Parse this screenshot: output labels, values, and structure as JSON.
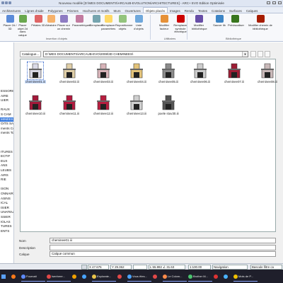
{
  "window": {
    "title": "Nouveau modèle [D:\\MES DOCUMENTS\\ARCAUB-EVOLUTION\\ARCHITECTURES] - ARC+ EVO Edition Optimisée"
  },
  "tabs": [
    "Architectures",
    "Lignes d'aide",
    "Polygones",
    "Prismes",
    "Hachures et motifs",
    "Murs",
    "Ouvertures",
    "Objets placés",
    "Images",
    "Rendu",
    "Textes",
    "Cotations",
    "Surfaces",
    "Calques"
  ],
  "ribbon": {
    "buttons": [
      {
        "label": "Placer 2d / 3D"
      },
      {
        "label": "Placer objet 2d dans calque"
      },
      {
        "label": "Pétales 3D"
      },
      {
        "label": "Aléatoire"
      },
      {
        "label": "Placer sur un chemin"
      },
      {
        "label": "Paramétriques"
      },
      {
        "label": "Remplacer"
      },
      {
        "label": "Remplacer paramètres"
      },
      {
        "label": "Repositionner objets"
      },
      {
        "label": "Liste d'objets"
      },
      {
        "label": "Modifier facteur"
      },
      {
        "label": "Remplacer symbole électrique"
      },
      {
        "label": "Modifier bibliothèque"
      },
      {
        "label": "Sauver lib"
      },
      {
        "label": "Prévisualiser"
      },
      {
        "label": "Modifier chemin de bibliothèque"
      }
    ],
    "groups": [
      "Insertion d'objets",
      "Utilitaires",
      "Bibliothèque"
    ]
  },
  "left_panel": {
    "items": [
      "",
      "",
      "",
      "",
      "",
      "",
      "",
      "",
      "",
      "",
      "ESSORIES",
      "AIRE",
      "UIER",
      "",
      "RAUX",
      "S CAM",
      "MINÉES",
      "OITS SAN",
      "ments Con",
      "ments Tom",
      "",
      "",
      "",
      "ITURES",
      "ECTIF",
      "EUX",
      "ANS",
      "LEUBS",
      "AIRS",
      "RIE",
      "",
      "ISON",
      "ONNAIRES",
      "ASINS",
      "ICAL",
      "ISIER",
      "UNATEUR",
      "SSIER",
      "IOLAS",
      "TURES",
      "ENTS",
      "",
      "",
      "",
      ""
    ],
    "selected_index": 16
  },
  "browser": {
    "catalog_button": "Catalogue...",
    "path": "D:\\MES DOCUMENTS\\ARCAUB-EVO\\2008\\3D CHEMINEES\\",
    "files": [
      {
        "name": "cheminee01.iii",
        "color": "#d9d9e6"
      },
      {
        "name": "cheminee02.iii",
        "color": "#e0cfa8"
      },
      {
        "name": "cheminee03.iii",
        "color": "#d7b3b8"
      },
      {
        "name": "cheminee04.iii",
        "color": "#e3c37a"
      },
      {
        "name": "cheminee05.iii",
        "color": "#8b8b8b"
      },
      {
        "name": "cheminee06.iii",
        "color": "#cccccc"
      },
      {
        "name": "cheminee07.iii",
        "color": "#9d1d35"
      },
      {
        "name": "cheminee08.iii",
        "color": "#c9b9b9"
      },
      {
        "name": "cheminee10.iii",
        "color": "#a3193a"
      },
      {
        "name": "cheminee11.iii",
        "color": "#b21b3f"
      },
      {
        "name": "cheminee12.iii",
        "color": "#b61e3f"
      },
      {
        "name": "cheminee13.iii",
        "color": "#cfcfcf"
      },
      {
        "name": "poele stuv30.iii",
        "color": "#555555"
      }
    ],
    "selected_index": 0
  },
  "form": {
    "nom_label": "Nom",
    "nom_value": "cheminee01.iii",
    "description_label": "Description",
    "description_value": "",
    "calque_label": "Calque",
    "calque_value": "Calque commun"
  },
  "statusbar": {
    "x": "47.676",
    "y": "29.362",
    "l": "55.992",
    "angle": "31.63",
    "scale": "1:100.00",
    "mode": "Navigation",
    "filter": "Bascule filtre ca"
  },
  "taskbar": {
    "items": [
      {
        "label": "",
        "color": "#ff7a1a"
      },
      {
        "label": "Fournait",
        "color": "#5e8bff"
      },
      {
        "label": "Isenhere...",
        "color": "#e14848"
      },
      {
        "label": "",
        "color": "#f0a000"
      },
      {
        "label": "",
        "color": "#48a3ff"
      },
      {
        "label": "Explorate...",
        "color": "#e9c34a"
      },
      {
        "label": "",
        "color": "#e14848"
      },
      {
        "label": "Vous êtes...",
        "color": "#4aa3ff"
      },
      {
        "label": "",
        "color": "#e14848"
      },
      {
        "label": "Le Colom...",
        "color": "#ff8b4a"
      },
      {
        "label": "Brother M...",
        "color": "#4ac36e"
      },
      {
        "label": "",
        "color": "#d33"
      },
      {
        "label": "",
        "color": "#4ab3ff"
      },
      {
        "label": "Mots de P...",
        "color": "#f0c000"
      }
    ]
  }
}
